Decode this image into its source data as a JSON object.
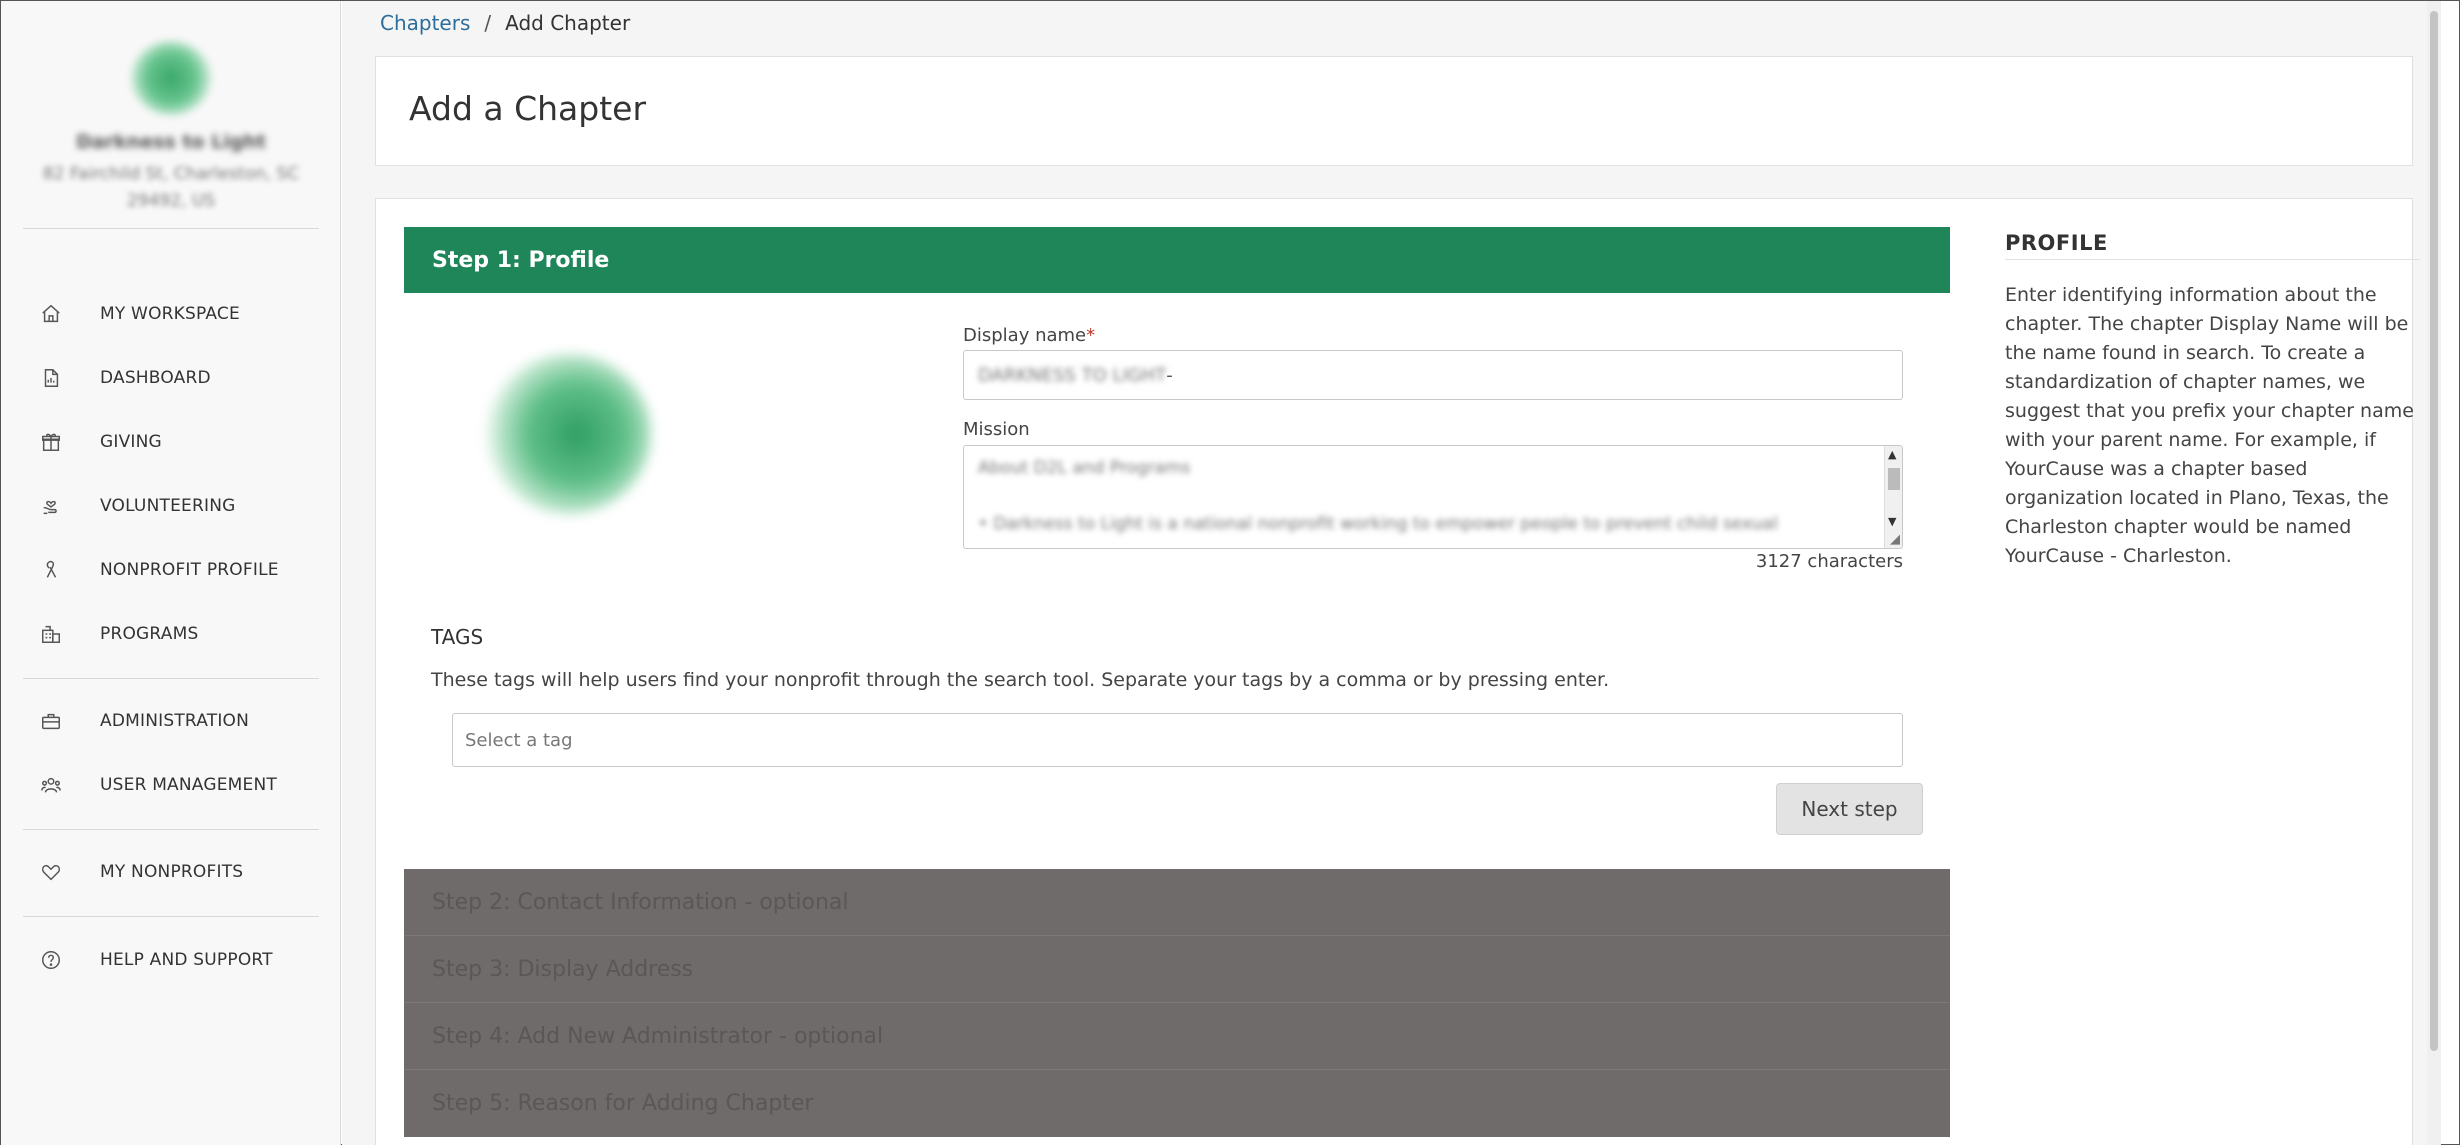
{
  "org": {
    "name": "Darkness to Light",
    "address": "82 Fairchild St, Charleston, SC 29492, US"
  },
  "nav": {
    "items": [
      {
        "label": "MY WORKSPACE",
        "icon": "home-icon"
      },
      {
        "label": "DASHBOARD",
        "icon": "document-icon"
      },
      {
        "label": "GIVING",
        "icon": "gift-icon"
      },
      {
        "label": "VOLUNTEERING",
        "icon": "hand-heart-icon"
      },
      {
        "label": "NONPROFIT PROFILE",
        "icon": "ribbon-icon"
      },
      {
        "label": "PROGRAMS",
        "icon": "building-icon"
      },
      {
        "label": "ADMINISTRATION",
        "icon": "briefcase-icon"
      },
      {
        "label": "USER MANAGEMENT",
        "icon": "users-icon"
      },
      {
        "label": "MY NONPROFITS",
        "icon": "heart-icon"
      },
      {
        "label": "HELP AND SUPPORT",
        "icon": "question-icon"
      }
    ]
  },
  "breadcrumb": {
    "link": "Chapters",
    "separator": "/",
    "current": "Add Chapter"
  },
  "page": {
    "title": "Add a Chapter"
  },
  "step1": {
    "header": "Step 1: Profile",
    "display_name_label": "Display name",
    "required_mark": "*",
    "display_name_value": "DARKNESS TO LIGHT",
    "display_name_suffix": " -",
    "mission_label": "Mission",
    "mission_line1": "About D2L and Programs",
    "mission_line2": "•    Darkness to Light is a national nonprofit working to empower people to prevent child sexual",
    "char_count": "3127 characters",
    "tags_title": "TAGS",
    "tags_desc": "These tags will help users find your nonprofit through the search tool. Separate your tags by a comma or by pressing enter.",
    "tag_placeholder": "Select a tag",
    "next_label": "Next step"
  },
  "steps": [
    "Step 2: Contact Information - optional",
    "Step 3: Display Address",
    "Step 4: Add New Administrator - optional",
    "Step 5: Reason for Adding Chapter"
  ],
  "help": {
    "title": "PROFILE",
    "text": "Enter identifying information about the chapter. The chapter Display Name will be the name found in search. To create a standardization of chapter names, we suggest that you prefix your chapter name with your parent name. For example, if YourCause was a chapter based organization located in Plano, Texas, the Charleston chapter would be named YourCause - Charleston."
  },
  "colors": {
    "step_header": "#1f865a",
    "link": "#2c6d9a",
    "collapsed_steps": "#6e6b6a"
  }
}
